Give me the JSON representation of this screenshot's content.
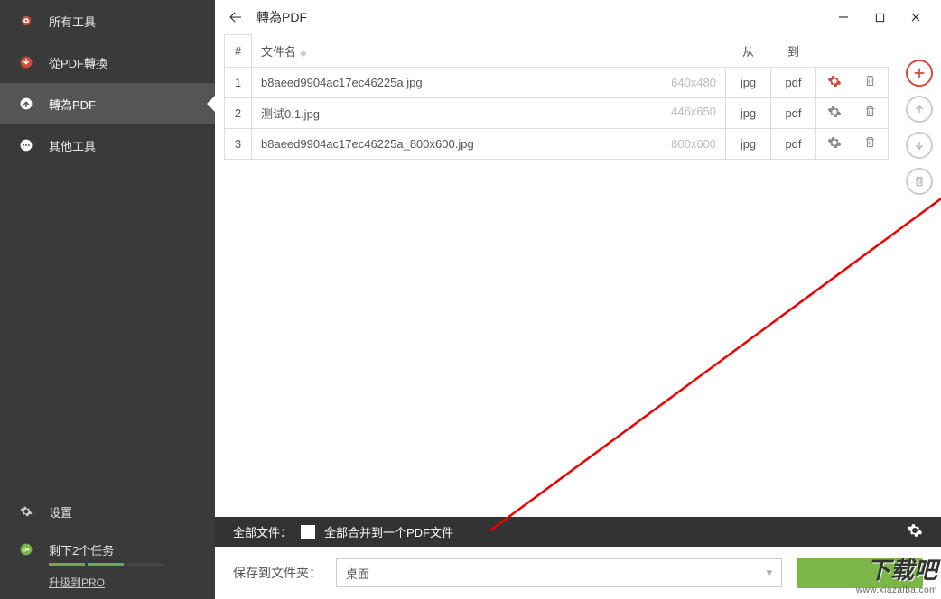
{
  "sidebar": {
    "items": [
      {
        "label": "所有工具",
        "icon": "target"
      },
      {
        "label": "從PDF轉換",
        "icon": "arrow-down"
      },
      {
        "label": "轉為PDF",
        "icon": "arrow-up"
      },
      {
        "label": "其他工具",
        "icon": "dots"
      }
    ],
    "settings_label": "设置",
    "tasks_label": "剩下2个任务",
    "upgrade_label": "升级到PRO"
  },
  "titlebar": {
    "title": "轉為PDF"
  },
  "table": {
    "headers": {
      "num": "#",
      "filename": "文件名",
      "from": "从",
      "to": "到"
    },
    "rows": [
      {
        "num": "1",
        "filename": "b8aeed9904ac17ec46225a.jpg",
        "dim": "640x480",
        "from": "jpg",
        "to": "pdf",
        "gear_active": true
      },
      {
        "num": "2",
        "filename": "测试0.1.jpg",
        "dim": "446x650",
        "from": "jpg",
        "to": "pdf",
        "gear_active": false
      },
      {
        "num": "3",
        "filename": "b8aeed9904ac17ec46225a_800x600.jpg",
        "dim": "800x600",
        "from": "jpg",
        "to": "pdf",
        "gear_active": false
      }
    ]
  },
  "footer": {
    "all_files_label": "全部文件：",
    "merge_label": "全部合并到一个PDF文件",
    "save_to_label": "保存到文件夹：",
    "save_location": "桌面"
  },
  "watermark": {
    "big": "下载吧",
    "small": "www.xiazaiba.com"
  }
}
